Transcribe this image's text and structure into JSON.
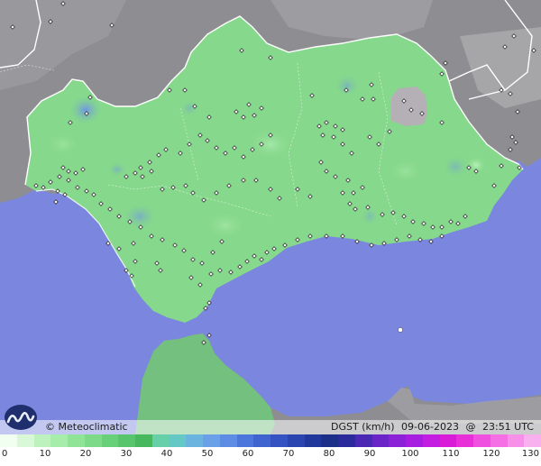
{
  "map": {
    "credit": "© Meteoclimatic",
    "variable": "DGST (km/h)",
    "date": "09-06-2023",
    "time_sep": "@",
    "time": "23:51 UTC"
  },
  "legend": {
    "ticks": [
      "0",
      "10",
      "20",
      "30",
      "40",
      "50",
      "60",
      "70",
      "80",
      "90",
      "100",
      "110",
      "120",
      "130"
    ],
    "colors": [
      "#f0fff0",
      "#d8f8d8",
      "#bdf2be",
      "#a6ecaa",
      "#8fe497",
      "#7cda88",
      "#67d078",
      "#58c46c",
      "#48b85f",
      "#68d0a8",
      "#64c8c4",
      "#6cb4e0",
      "#6aa0e8",
      "#5c8ce4",
      "#4c76dc",
      "#3f64d0",
      "#3452c2",
      "#2a44b0",
      "#20389c",
      "#1c2f88",
      "#2a2a9c",
      "#4a28b4",
      "#6a24c8",
      "#8c22d8",
      "#a81ee0",
      "#c41ce0",
      "#d81cd8",
      "#e830d8",
      "#f050e0",
      "#f470e4",
      "#f690e8",
      "#f8b0ee"
    ]
  }
}
